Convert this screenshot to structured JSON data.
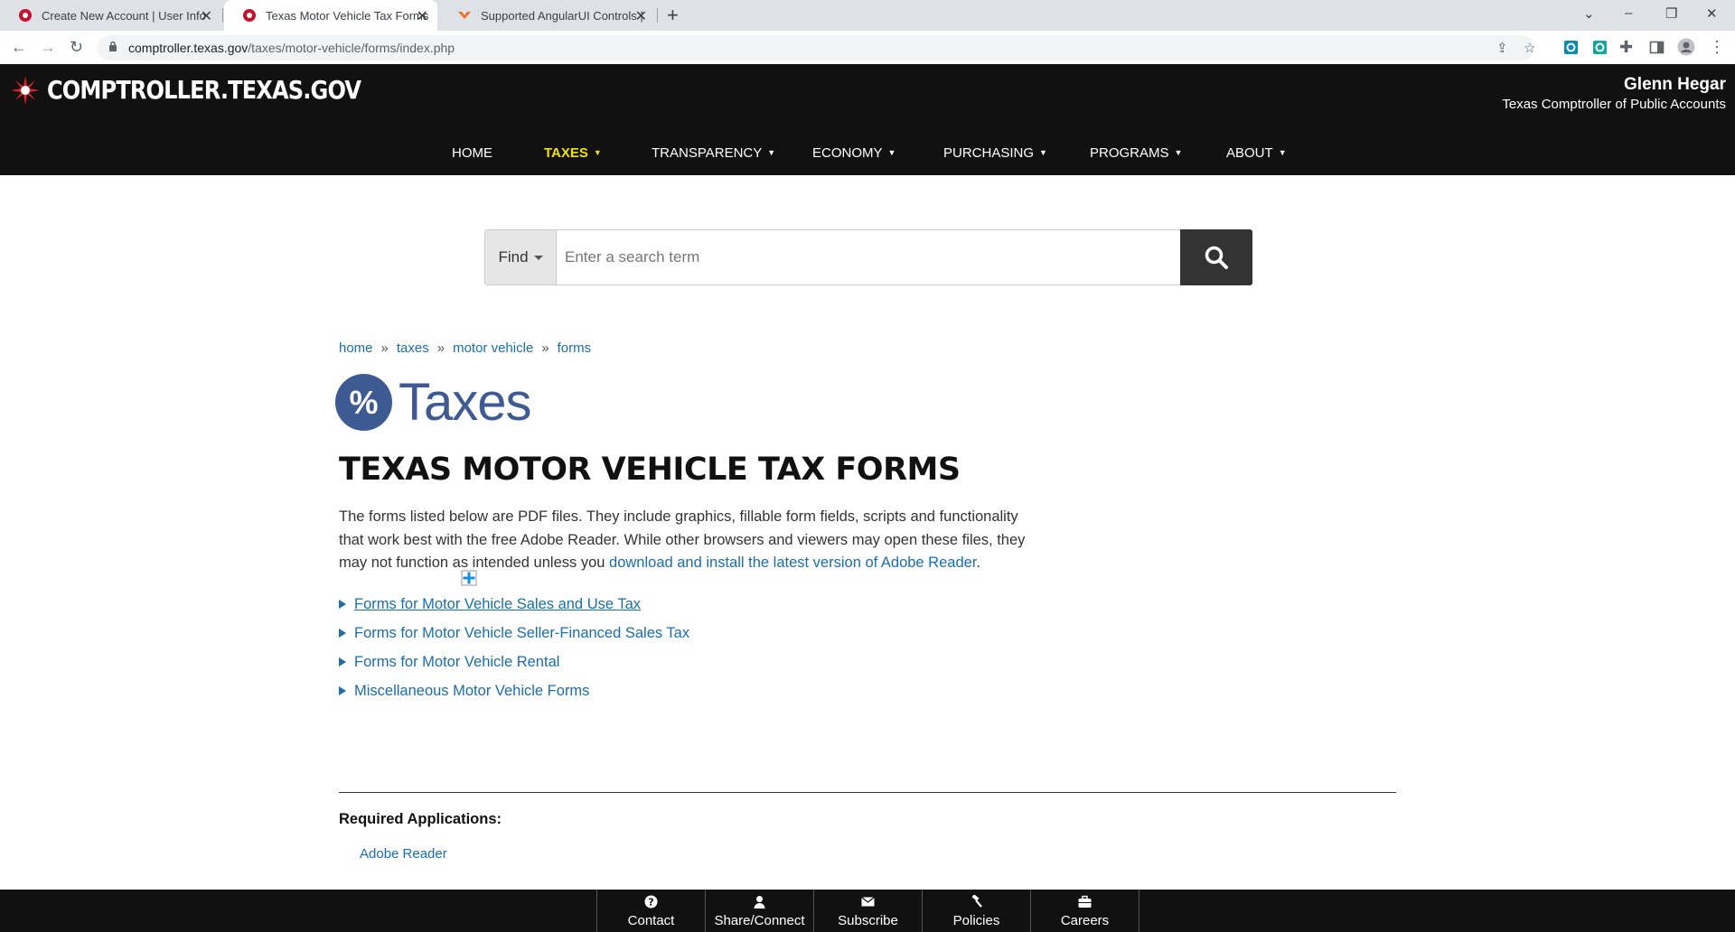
{
  "browser": {
    "tabs": [
      {
        "title": "Create New Account | User Inform",
        "active": false
      },
      {
        "title": "Texas Motor Vehicle Tax Forms",
        "active": true
      },
      {
        "title": "Supported AngularUI Controls | T",
        "active": false
      }
    ],
    "url_host": "comptroller.texas.gov",
    "url_path": "/taxes/motor-vehicle/forms/index.php"
  },
  "header": {
    "brand": "COMPTROLLER.TEXAS.GOV",
    "official_name": "Glenn Hegar",
    "official_title": "Texas Comptroller of Public Accounts",
    "nav": [
      {
        "label": "HOME",
        "caret": false
      },
      {
        "label": "TAXES",
        "caret": true
      },
      {
        "label": "TRANSPARENCY",
        "caret": true
      },
      {
        "label": "ECONOMY",
        "caret": true
      },
      {
        "label": "PURCHASING",
        "caret": true
      },
      {
        "label": "PROGRAMS",
        "caret": true
      },
      {
        "label": "ABOUT",
        "caret": true
      }
    ],
    "active_nav": "TAXES"
  },
  "search": {
    "find_label": "Find",
    "placeholder": "Enter a search term"
  },
  "breadcrumb": [
    "home",
    "taxes",
    "motor vehicle",
    "forms"
  ],
  "section": {
    "badge": "%",
    "label": "Taxes"
  },
  "page": {
    "title": "TEXAS MOTOR VEHICLE TAX FORMS",
    "intro_text": "The forms listed below are PDF files. They include graphics, fillable form fields, scripts and functionality that work best with the free Adobe Reader. While other browsers and viewers may open these files, they may not function as intended unless you ",
    "intro_link": "download and install the latest version of Adobe Reader",
    "intro_end": ".",
    "form_links": [
      "Forms for Motor Vehicle Sales and Use Tax",
      "Forms for Motor Vehicle Seller-Financed Sales Tax",
      "Forms for Motor Vehicle Rental",
      "Miscellaneous Motor Vehicle Forms"
    ],
    "required_heading": "Required Applications:",
    "required_link": "Adobe Reader"
  },
  "footer": {
    "items": [
      {
        "label": "Contact",
        "icon": "question-circle-icon"
      },
      {
        "label": "Share/Connect",
        "icon": "user-icon"
      },
      {
        "label": "Subscribe",
        "icon": "envelope-icon"
      },
      {
        "label": "Policies",
        "icon": "gavel-icon"
      },
      {
        "label": "Careers",
        "icon": "briefcase-icon"
      }
    ]
  },
  "colors": {
    "header_bg": "#111111",
    "nav_active": "#f0e300",
    "link": "#1a6ea8",
    "taxes_blue": "#3e5a93",
    "search_button": "#333333"
  }
}
